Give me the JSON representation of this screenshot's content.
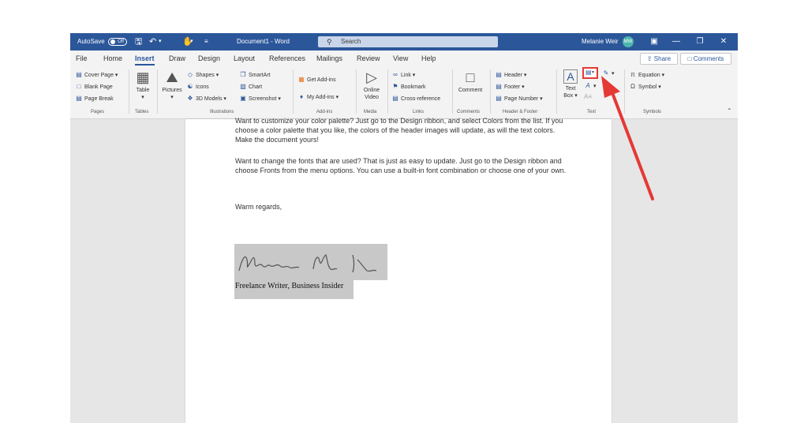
{
  "titlebar": {
    "autosave_label": "AutoSave",
    "autosave_state": "Off",
    "document_title": "Document1  -  Word",
    "search_placeholder": "Search",
    "user_name": "Melanie Weir",
    "user_initials": "MW"
  },
  "tabs": [
    "File",
    "Home",
    "Insert",
    "Draw",
    "Design",
    "Layout",
    "References",
    "Mailings",
    "Review",
    "View",
    "Help"
  ],
  "active_tab": "Insert",
  "share_label": "Share",
  "comments_label": "Comments",
  "ribbon": {
    "pages": {
      "group": "Pages",
      "cover_page": "Cover Page",
      "blank_page": "Blank Page",
      "page_break": "Page Break"
    },
    "tables": {
      "group": "Tables",
      "table": "Table"
    },
    "illustrations": {
      "group": "Illustrations",
      "pictures": "Pictures",
      "shapes": "Shapes",
      "icons": "Icons",
      "models": "3D Models",
      "smartart": "SmartArt",
      "chart": "Chart",
      "screenshot": "Screenshot"
    },
    "addins": {
      "group": "Add-ins",
      "get_addins": "Get Add-ins",
      "my_addins": "My Add-ins"
    },
    "media": {
      "group": "Media",
      "online": "Online",
      "video": "Video"
    },
    "links": {
      "group": "Links",
      "link": "Link",
      "bookmark": "Bookmark",
      "crossref": "Cross-reference"
    },
    "comments": {
      "group": "Comments",
      "comment": "Comment"
    },
    "header_footer": {
      "group": "Header & Footer",
      "header": "Header",
      "footer": "Footer",
      "page_number": "Page Number"
    },
    "text": {
      "group": "Text",
      "text": "Text",
      "box": "Box"
    },
    "symbols": {
      "group": "Symbols",
      "equation": "Equation",
      "symbol": "Symbol"
    }
  },
  "document": {
    "para1": "Want to customize your color palette?  Just go to the Design ribbon, and select Colors from the list.  If you choose a color palette that you like, the colors of the header images will update, as will the text colors.  Make the document yours!",
    "para2": "Want to change the fonts that are used?  That is just as easy to update.  Just go to the Design ribbon and choose Fronts from the menu options.  You can use a built-in font combination or choose one of your own.",
    "closing": "Warm regards,",
    "signature_title": "Freelance Writer, Business Insider"
  },
  "colors": {
    "titlebar": "#2b579a",
    "highlight": "#e53935",
    "avatar": "#4db6ac"
  }
}
